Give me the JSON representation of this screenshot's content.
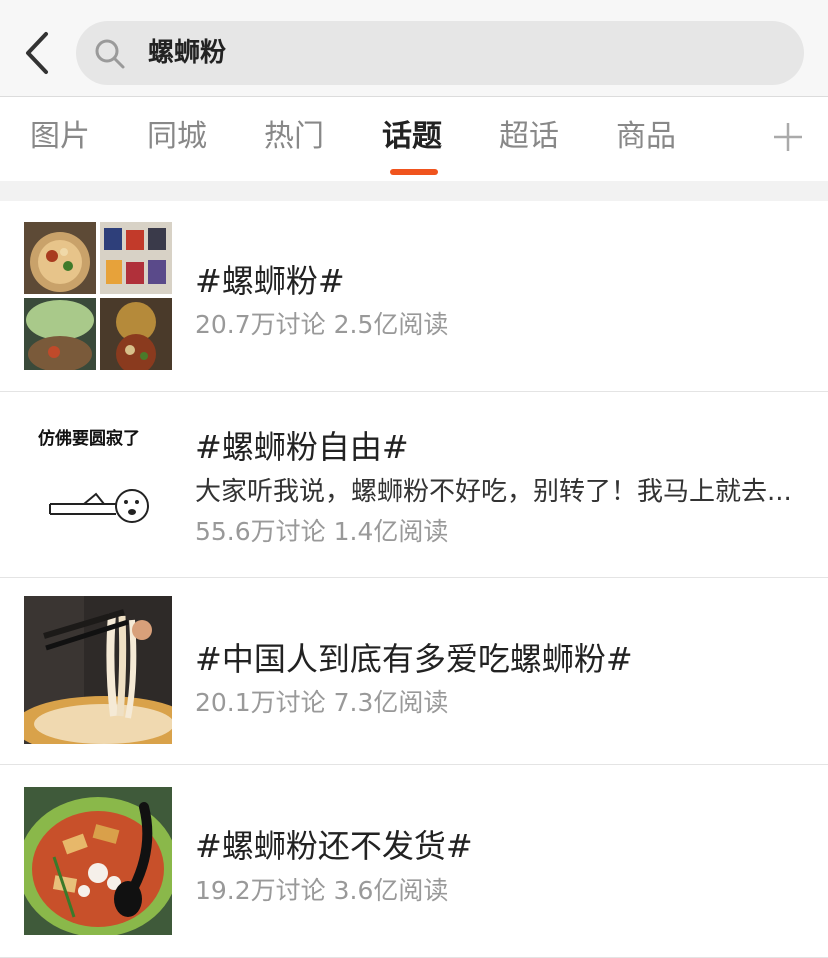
{
  "search": {
    "query": "螺蛳粉"
  },
  "tabs": [
    {
      "label": "图片"
    },
    {
      "label": "同城"
    },
    {
      "label": "热门"
    },
    {
      "label": "话题",
      "active": true
    },
    {
      "label": "超话"
    },
    {
      "label": "商品"
    }
  ],
  "topics": [
    {
      "title": "#螺蛳粉#",
      "stats": "20.7万讨论 2.5亿阅读"
    },
    {
      "title": "#螺蛳粉自由#",
      "desc": "大家听我说，螺蛳粉不好吃，别转了！我马上就去...",
      "stats": "55.6万讨论 1.4亿阅读",
      "thumb_caption": "仿佛要圆寂了"
    },
    {
      "title": "#中国人到底有多爱吃螺蛳粉#",
      "stats": "20.1万讨论 7.3亿阅读"
    },
    {
      "title": "#螺蛳粉还不发货#",
      "stats": "19.2万讨论 3.6亿阅读"
    }
  ],
  "colors": {
    "accent": "#f0541e",
    "header_bg": "#f7f7f7",
    "search_bg": "#e6e6e6"
  },
  "icons": {
    "back": "chevron-left-icon",
    "search": "search-icon",
    "add": "plus-icon"
  }
}
